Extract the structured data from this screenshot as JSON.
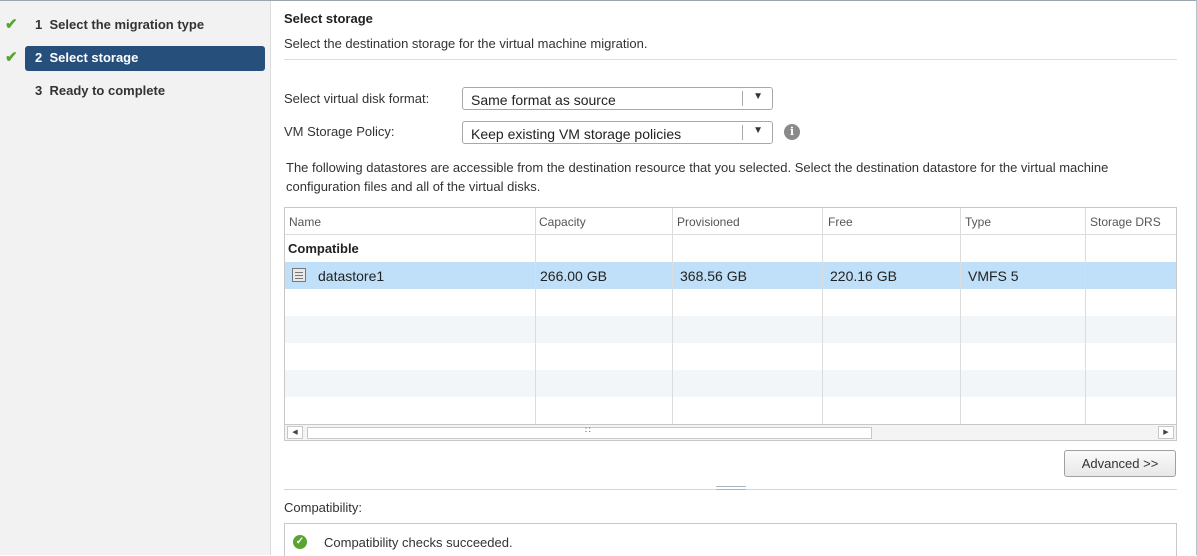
{
  "wizard": {
    "steps": [
      {
        "number": "1",
        "label": "Select the migration type",
        "completed": true
      },
      {
        "number": "2",
        "label": "Select storage",
        "completed": true,
        "active": true
      },
      {
        "number": "3",
        "label": "Ready to complete",
        "completed": false
      }
    ]
  },
  "page": {
    "title": "Select storage",
    "subtitle": "Select the destination storage for the virtual machine migration."
  },
  "form": {
    "disk_format_label": "Select virtual disk format:",
    "disk_format_value": "Same format as source",
    "storage_policy_label": "VM Storage Policy:",
    "storage_policy_value": "Keep existing VM storage policies"
  },
  "description": "The following datastores are accessible from the destination resource that you selected. Select the destination datastore for the virtual machine configuration files and all of the virtual disks.",
  "table": {
    "columns": [
      "Name",
      "Capacity",
      "Provisioned",
      "Free",
      "Type",
      "Storage DRS"
    ],
    "group_label": "Compatible",
    "rows": [
      {
        "name": "datastore1",
        "capacity": "266.00 GB",
        "provisioned": "368.56 GB",
        "free": "220.16 GB",
        "type": "VMFS 5",
        "storage_drs": ""
      }
    ]
  },
  "advanced_button": "Advanced >>",
  "compatibility": {
    "label": "Compatibility:",
    "message": "Compatibility checks succeeded."
  },
  "colors": {
    "active_step_bg": "#264f7b",
    "selected_row_bg": "#bfe0f8",
    "check_green": "#5aa532"
  }
}
